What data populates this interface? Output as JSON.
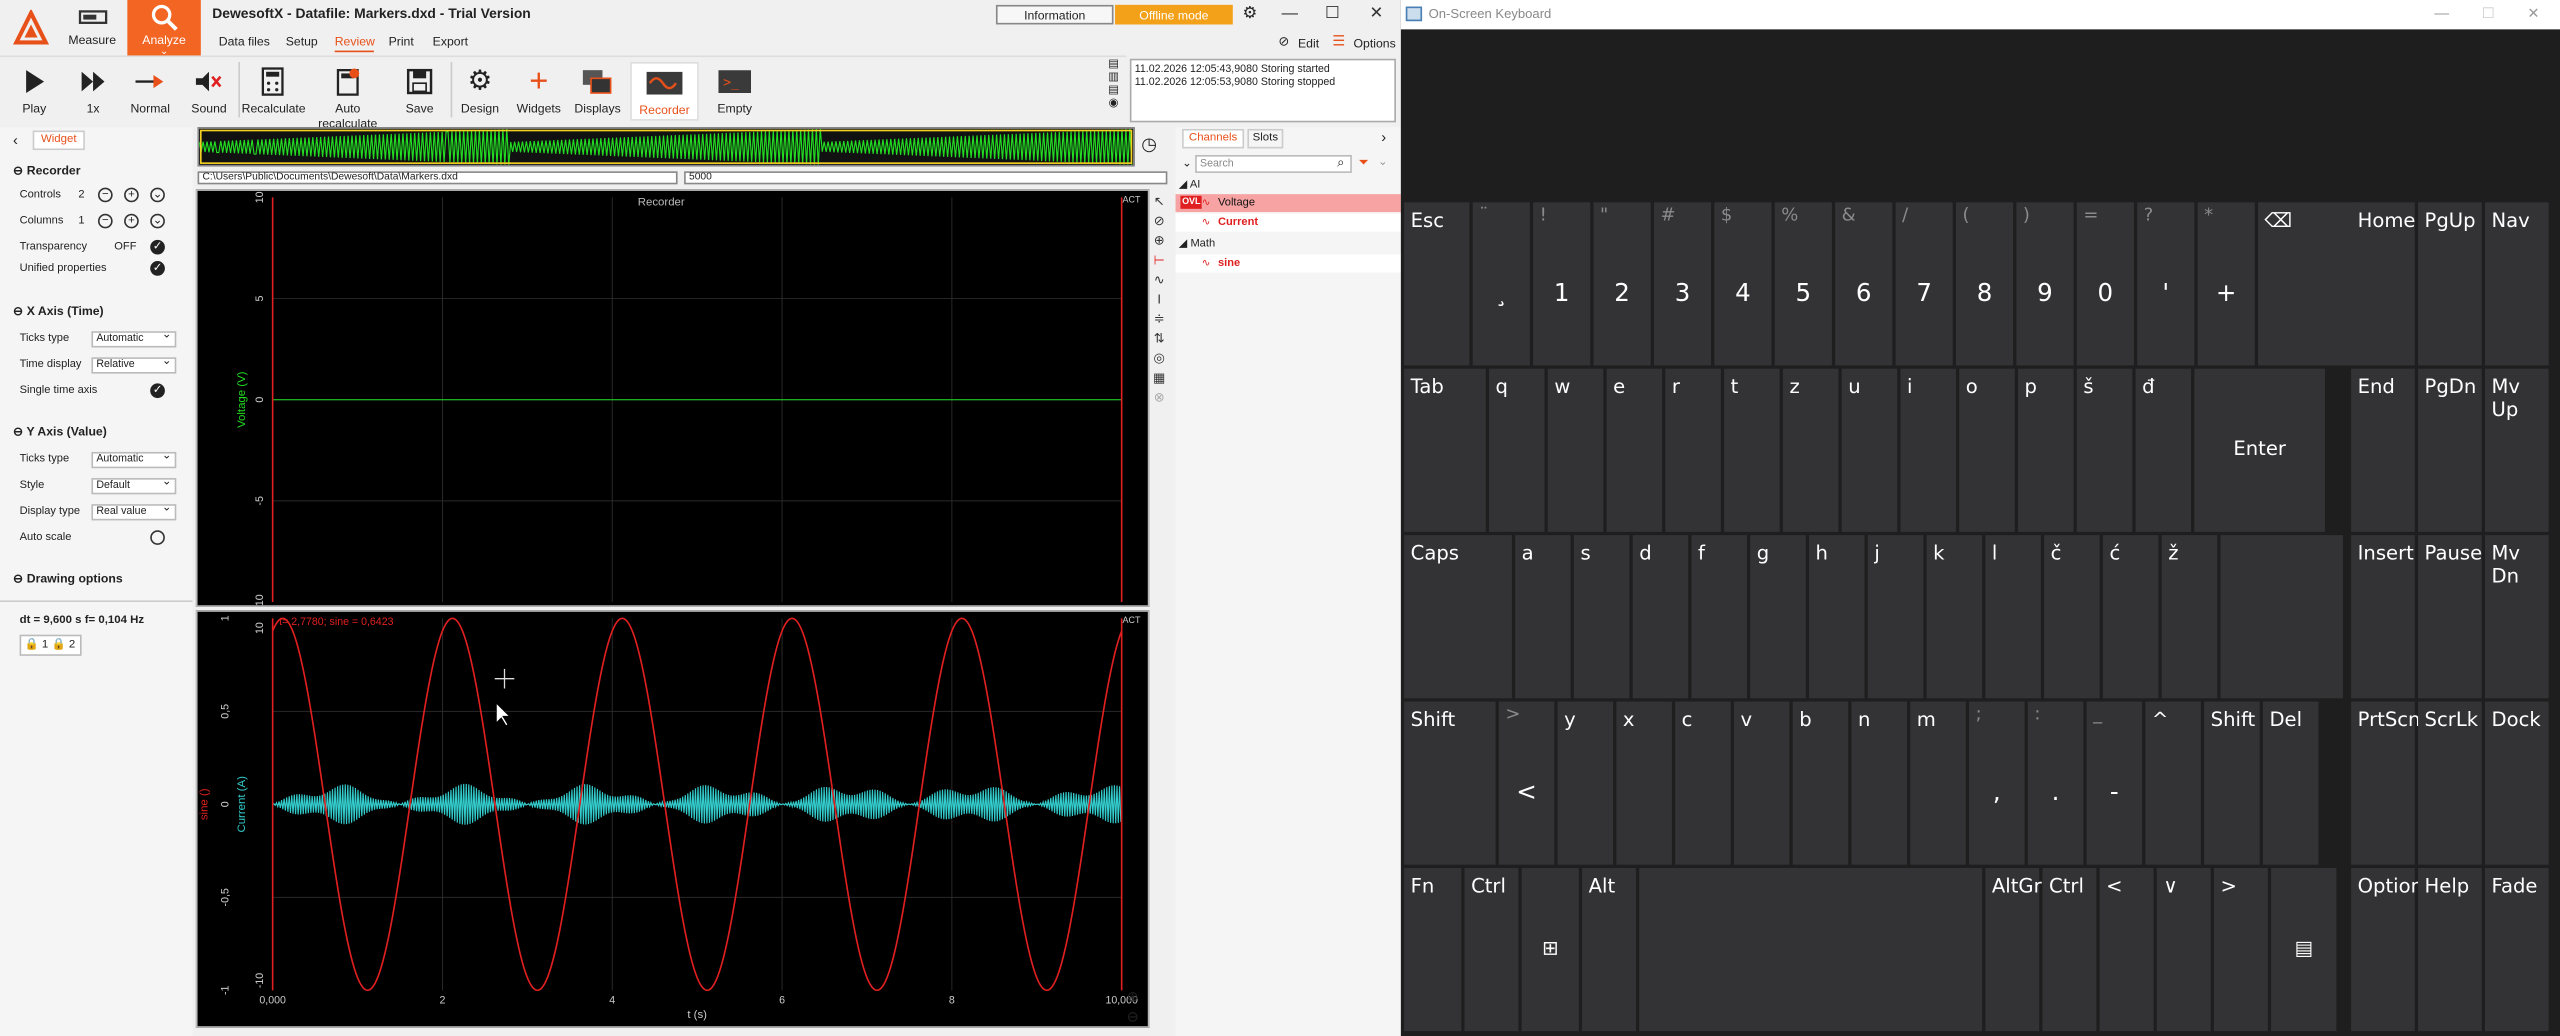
{
  "app": {
    "title": "DewesoftX - Datafile: Markers.dxd - Trial Version",
    "modes": [
      "Measure",
      "Analyze"
    ],
    "menu": [
      "Data files",
      "Setup",
      "Review",
      "Print",
      "Export"
    ],
    "active_menu": "Review",
    "information_label": "Information",
    "offline_label": "Offline mode",
    "edit_label": "Edit",
    "options_label": "Options",
    "accent": "#f26522"
  },
  "toolbar": {
    "play": "Play",
    "speed": "1x",
    "normal": "Normal",
    "sound": "Sound",
    "recalculate": "Recalculate",
    "auto_recalculate": "Auto recalculate",
    "save": "Save",
    "design": "Design",
    "widgets": "Widgets",
    "displays": "Displays",
    "recorder": "Recorder",
    "empty": "Empty"
  },
  "log": [
    "11.02.2026 12:05:43,9080 Storing started",
    "11.02.2026 12:05:53,9080 Storing stopped"
  ],
  "left_panel": {
    "tab": "Widget",
    "recorder": {
      "title": "Recorder",
      "controls_label": "Controls",
      "controls_value": "2",
      "columns_label": "Columns",
      "columns_value": "1",
      "transparency_label": "Transparency",
      "transparency_value": "OFF",
      "unified_label": "Unified properties"
    },
    "xaxis": {
      "title": "X Axis (Time)",
      "ticks_label": "Ticks type",
      "ticks_value": "Automatic",
      "time_display_label": "Time display",
      "time_display_value": "Relative",
      "single_time_label": "Single time axis"
    },
    "yaxis": {
      "title": "Y Axis (Value)",
      "ticks_label": "Ticks type",
      "ticks_value": "Automatic",
      "style_label": "Style",
      "style_value": "Default",
      "display_type_label": "Display type",
      "display_type_value": "Real value",
      "auto_scale_label": "Auto scale"
    },
    "drawing_options": "Drawing options",
    "dt_readout": "dt = 9,600 s  f= 0,104 Hz",
    "lock1": "1",
    "lock2": "2"
  },
  "recorder": {
    "path": "C:\\Users\\Public\\Documents\\Dewesoft\\Data\\Markers.dxd",
    "value_field": "5000",
    "title": "Recorder",
    "act": "ACT",
    "act2": "ACT",
    "cursor_readout": "t= 2,7780; sine = 0,6423",
    "top_ylabel": "Voltage (V)",
    "top_yticks": [
      "10",
      "5",
      "0",
      "-5",
      "-10"
    ],
    "bottom_ylabel_a": "Current (A)",
    "bottom_ylabel_b": "sine ()",
    "bottom_yticks": [
      "1",
      "0,5",
      "0",
      "-0,5",
      "-1"
    ],
    "bottom_ytick_ends": [
      "10",
      "-10"
    ],
    "xticks": [
      "0,000",
      "2",
      "4",
      "6",
      "8",
      "10,000"
    ],
    "xlabel": "t (s)",
    "colors": {
      "voltage": "#22dd22",
      "current": "#33cccc",
      "sine": "#e02020"
    }
  },
  "channels": {
    "tabs": [
      "Channels",
      "Slots"
    ],
    "search_placeholder": "Search",
    "groups": [
      {
        "name": "AI",
        "items": [
          {
            "label": "Voltage",
            "badge": "OVL"
          },
          {
            "label": "Current"
          }
        ]
      },
      {
        "name": "Math",
        "items": [
          {
            "label": "sine"
          }
        ]
      }
    ]
  },
  "keyboard": {
    "title": "On-Screen Keyboard",
    "row1": [
      {
        "main": "Esc"
      },
      {
        "top": "¨",
        "bottom": "¸"
      },
      {
        "top": "!",
        "bottom": "1"
      },
      {
        "top": "\"",
        "bottom": "2"
      },
      {
        "top": "#",
        "bottom": "3"
      },
      {
        "top": "$",
        "bottom": "4"
      },
      {
        "top": "%",
        "bottom": "5"
      },
      {
        "top": "&",
        "bottom": "6"
      },
      {
        "top": "/",
        "bottom": "7"
      },
      {
        "top": "(",
        "bottom": "8"
      },
      {
        "top": ")",
        "bottom": "9"
      },
      {
        "top": "=",
        "bottom": "0"
      },
      {
        "top": "?",
        "bottom": "'"
      },
      {
        "top": "*",
        "bottom": "+"
      },
      {
        "main": "⌫"
      }
    ],
    "row2": [
      "Tab",
      "q",
      "w",
      "e",
      "r",
      "t",
      "z",
      "u",
      "i",
      "o",
      "p",
      "š",
      "đ",
      "Enter"
    ],
    "row3": [
      "Caps",
      "a",
      "s",
      "d",
      "f",
      "g",
      "h",
      "j",
      "k",
      "l",
      "č",
      "ć",
      "ž"
    ],
    "row4": [
      {
        "main": "Shift"
      },
      {
        "top": ">",
        "bottom": "<"
      },
      {
        "main": "y"
      },
      {
        "main": "x"
      },
      {
        "main": "c"
      },
      {
        "main": "v"
      },
      {
        "main": "b"
      },
      {
        "main": "n"
      },
      {
        "main": "m"
      },
      {
        "top": ";",
        "bottom": ","
      },
      {
        "top": ":",
        "bottom": "."
      },
      {
        "top": "_",
        "bottom": "-"
      },
      {
        "main": "^"
      },
      {
        "main": "Shift"
      },
      {
        "main": "Del"
      }
    ],
    "row5": [
      "Fn",
      "Ctrl",
      "⊞",
      "Alt",
      "",
      "AltGr",
      "Ctrl",
      "<",
      "∨",
      ">",
      "▤"
    ],
    "nav": [
      [
        "Home",
        "PgUp",
        "Nav"
      ],
      [
        "End",
        "PgDn",
        "Mv Up"
      ],
      [
        "Insert",
        "Pause",
        "Mv Dn"
      ],
      [
        "PrtScn",
        "ScrLk",
        "Dock"
      ],
      [
        "Options",
        "Help",
        "Fade"
      ]
    ]
  }
}
